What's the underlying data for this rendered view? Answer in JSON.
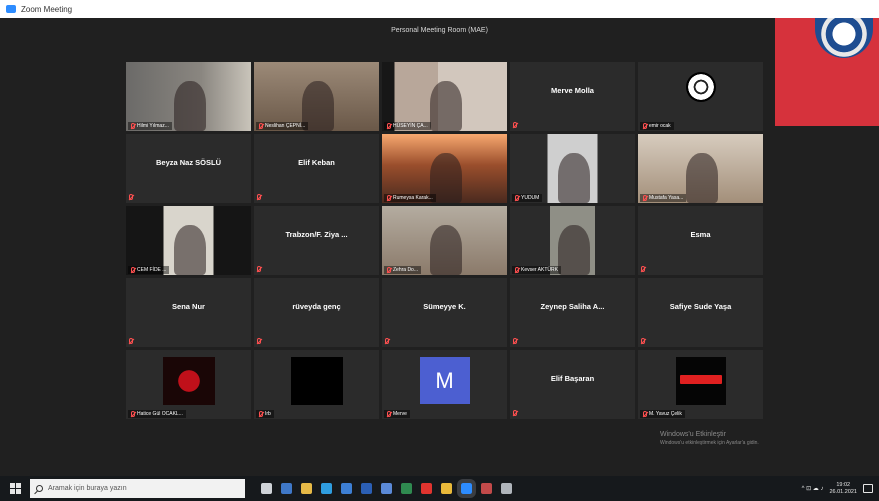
{
  "window": {
    "title": "Zoom Meeting",
    "topic": "Personal Meeting Room (MAE)"
  },
  "tiles": [
    {
      "kind": "video",
      "style": "v1",
      "label": "Hilmi Yılmaz..."
    },
    {
      "kind": "video",
      "style": "v2",
      "label": "Neslihan ÇEPNİ..."
    },
    {
      "kind": "video",
      "style": "v3",
      "label": "HÜSEYİN ÇA..."
    },
    {
      "kind": "name",
      "name": "Merve Molla"
    },
    {
      "kind": "flower",
      "label": "emir ocak"
    },
    {
      "kind": "name",
      "name": "Beyza Naz SÖSLÜ"
    },
    {
      "kind": "name",
      "name": "Elif Keban"
    },
    {
      "kind": "video",
      "style": "v4",
      "label": "Rumeysa Karak..."
    },
    {
      "kind": "video",
      "style": "v5",
      "label": "YUDUM"
    },
    {
      "kind": "video",
      "style": "v6",
      "label": "Mustafa Yasa..."
    },
    {
      "kind": "video",
      "style": "v7",
      "label": "CEM FİDE ...",
      "active": true
    },
    {
      "kind": "name",
      "name": "Trabzon/F. Ziya ..."
    },
    {
      "kind": "video",
      "style": "v8",
      "label": "Zehra Do..."
    },
    {
      "kind": "video",
      "style": "v9",
      "label": "Kevser AKTÜRK"
    },
    {
      "kind": "name",
      "name": "Esma"
    },
    {
      "kind": "name",
      "name": "Sena Nur"
    },
    {
      "kind": "name",
      "name": "rüveyda genç"
    },
    {
      "kind": "name",
      "name": "Sümeyye K."
    },
    {
      "kind": "name",
      "name": "Zeynep Saliha A..."
    },
    {
      "kind": "name",
      "name": "Safiye Sude Yaşa"
    },
    {
      "kind": "rose",
      "label": "Hatice Gül OCAKL..."
    },
    {
      "kind": "black",
      "label": "Irb"
    },
    {
      "kind": "avatar",
      "initial": "M",
      "label": "Merve"
    },
    {
      "kind": "name",
      "name": "Elif Başaran"
    },
    {
      "kind": "redlogo",
      "label": "M. Yavuz Çelik"
    }
  ],
  "watermark": {
    "line1": "Windows'u Etkinleştir",
    "line2": "Windows'u etkinleştirmek için Ayarlar'a gidin."
  },
  "taskbar": {
    "search_placeholder": "Aramak için buraya yazın",
    "icons": [
      {
        "name": "task-view-icon",
        "color": "#cfd3d8"
      },
      {
        "name": "store-icon",
        "color": "#3f78c8"
      },
      {
        "name": "file-explorer-icon",
        "color": "#e6b947"
      },
      {
        "name": "edge-icon",
        "color": "#2f9de0"
      },
      {
        "name": "mail-icon",
        "color": "#3d7fd4"
      },
      {
        "name": "word-icon",
        "color": "#2b5fb5"
      },
      {
        "name": "photos-icon",
        "color": "#5b8ad8"
      },
      {
        "name": "excel-icon",
        "color": "#2f8a50"
      },
      {
        "name": "opera-icon",
        "color": "#e0342f"
      },
      {
        "name": "chrome-icon",
        "color": "#e9b93a"
      },
      {
        "name": "zoom-icon",
        "color": "#2d8cff",
        "selected": true
      },
      {
        "name": "app-icon",
        "color": "#c24a4a"
      },
      {
        "name": "settings-icon",
        "color": "#b0b5bb"
      }
    ],
    "time": "19:02",
    "date": "26.01.2021",
    "tray_text": "^ ⊡ ☁ ♪"
  }
}
